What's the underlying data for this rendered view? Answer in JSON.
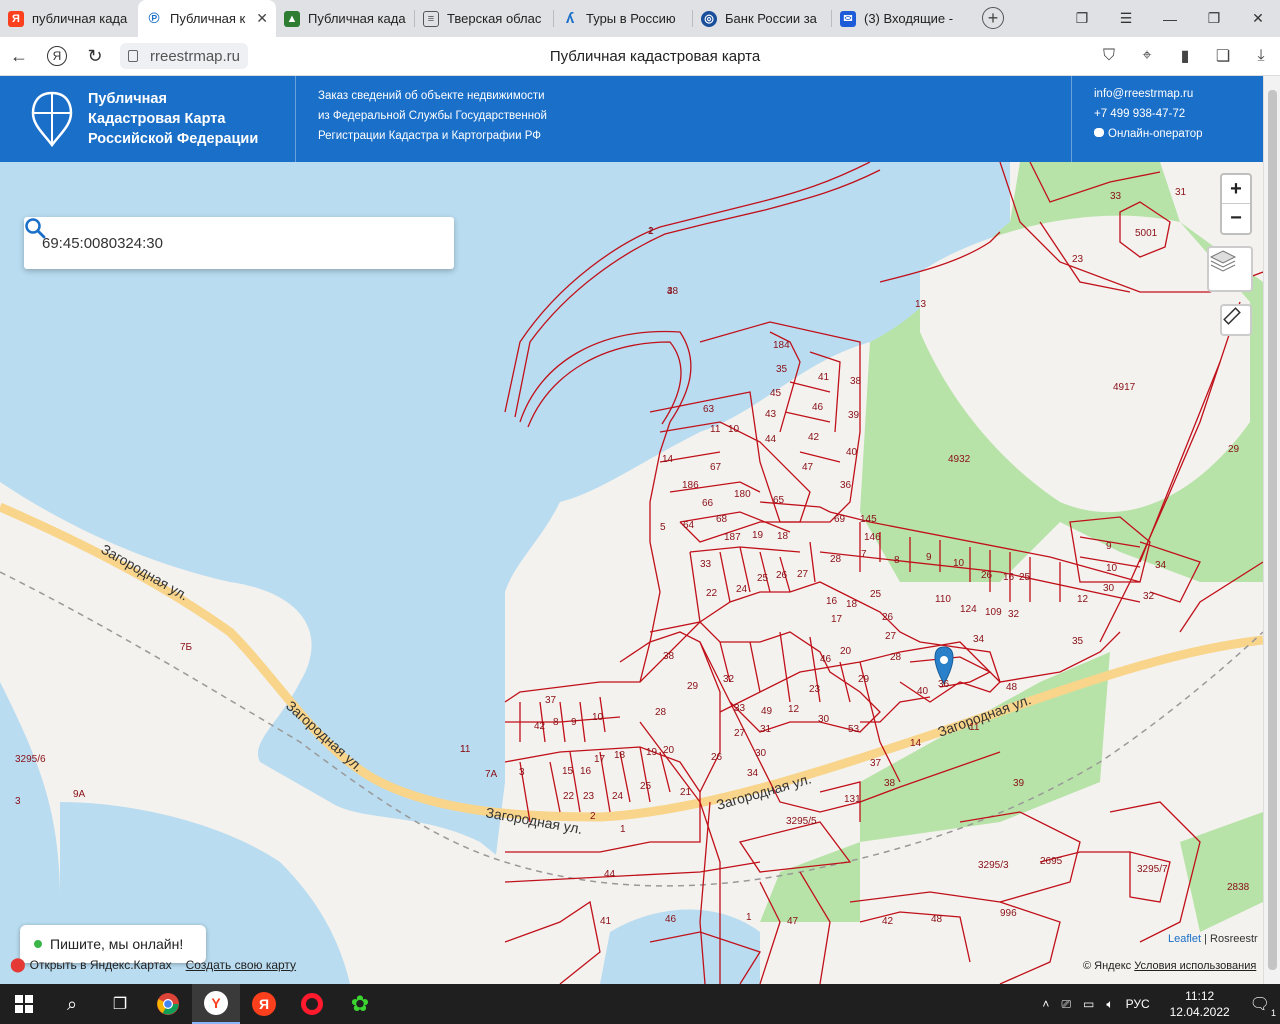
{
  "browser": {
    "tabs": [
      {
        "label": "публичная када",
        "icon": "yandex-icon",
        "color": "#fc3f1d"
      },
      {
        "label": "Публичная к",
        "icon": "rreestr-icon",
        "color": "#1a6fc8",
        "active": true
      },
      {
        "label": "Публичная када",
        "icon": "map-icon",
        "color": "#2e7d32"
      },
      {
        "label": "Тверская облас",
        "icon": "document-icon",
        "color": "#555555"
      },
      {
        "label": "Туры в Россию",
        "icon": "tour-icon",
        "color": "#1a6fc8"
      },
      {
        "label": "Банк России за",
        "icon": "bank-icon",
        "color": "#1a4f9c"
      },
      {
        "label": "(3) Входящие -",
        "icon": "mail-icon",
        "color": "#1e5bd8"
      }
    ],
    "url": "rreestrmap.ru",
    "page_title": "Публичная кадастровая карта"
  },
  "header": {
    "logo_line1": "Публичная",
    "logo_line2": "Кадастровая Карта",
    "logo_line3": "Российской Федерации",
    "order_line1": "Заказ сведений об объекте недвижимости",
    "order_line2": "из Федеральной Службы Государственной",
    "order_line3": "Регистрации Кадастра и Картографии РФ",
    "email": "info@rreestrmap.ru",
    "phone": "+7 499 938-47-72",
    "operator": "Онлайн-оператор"
  },
  "search": {
    "value": "69:45:0080324:30"
  },
  "map": {
    "zoom_in": "+",
    "zoom_out": "−",
    "street_labels": [
      "Загородная ул.",
      "Загородная ул.",
      "Загородная ул.",
      "Загородная ул.",
      "Загородная ул."
    ],
    "parcel_numbers": [
      "1",
      "48",
      "184",
      "35",
      "41",
      "38",
      "45",
      "46",
      "39",
      "43",
      "42",
      "40",
      "44",
      "47",
      "63",
      "11",
      "10",
      "14",
      "67",
      "186",
      "180",
      "65",
      "66",
      "68",
      "36",
      "69",
      "145",
      "146",
      "5",
      "64",
      "187",
      "19",
      "18",
      "28",
      "7",
      "8",
      "9",
      "10",
      "33",
      "25",
      "26",
      "27",
      "26",
      "16",
      "25",
      "22",
      "24",
      "25",
      "110",
      "124",
      "109",
      "32",
      "12",
      "16",
      "18",
      "17",
      "26",
      "27",
      "28",
      "20",
      "46",
      "34",
      "35",
      "38",
      "29",
      "32",
      "33",
      "28",
      "37",
      "42",
      "8",
      "9",
      "10",
      "11",
      "3",
      "15",
      "16",
      "17",
      "18",
      "19",
      "20",
      "21",
      "22",
      "23",
      "24",
      "25",
      "26",
      "27",
      "30",
      "31",
      "34",
      "49",
      "53",
      "14",
      "37",
      "38",
      "131",
      "39",
      "48",
      "40",
      "36",
      "29",
      "30",
      "23",
      "12",
      "11",
      "9",
      "10",
      "30",
      "34",
      "32",
      "33",
      "31",
      "5001",
      "4917",
      "4932",
      "29",
      "23",
      "13",
      "2",
      "1",
      "44",
      "46",
      "1",
      "47",
      "41",
      "42",
      "48",
      "996",
      "3295/3",
      "2695",
      "3295/7",
      "2838",
      "3295/5",
      "3295/6",
      "3",
      "9А",
      "7Б",
      "7А",
      "1",
      "2",
      "3"
    ],
    "leaflet": "Leaflet",
    "rosreestr": "Rosreestr",
    "yandex_copy": "© Яндекс",
    "terms": "Условия использования",
    "open_yandex": "Открыть в Яндекс.Картах",
    "create_map": "Создать свою карту"
  },
  "chat": {
    "label": "Пишите, мы онлайн!"
  },
  "taskbar": {
    "lang": "РУС",
    "time": "11:12",
    "date": "12.04.2022",
    "notifications": "1"
  },
  "colors": {
    "header_blue": "#1a6fc8",
    "water": "#b9dcf0",
    "parcel_red": "#c0101a",
    "green": "#b8e3a8"
  }
}
